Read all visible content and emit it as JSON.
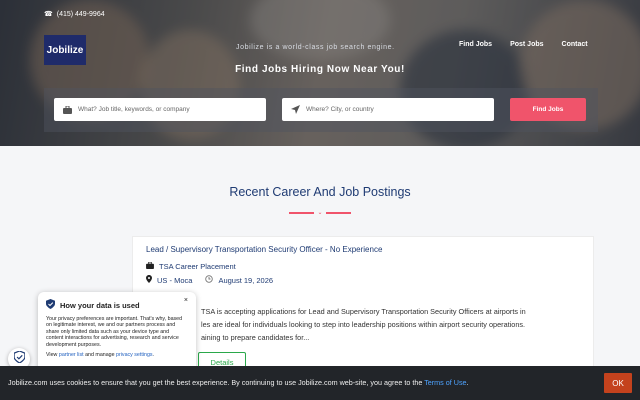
{
  "header": {
    "phone": "(415) 449-9964",
    "logo_text": "Jobilize",
    "tagline": "Jobilize is a world-class job search engine.",
    "nav": [
      "Find Jobs",
      "Post Jobs",
      "Contact"
    ],
    "hero_title": "Find Jobs Hiring Now Near You!"
  },
  "search": {
    "keyword_placeholder": "What? Job title, keywords, or company",
    "location_placeholder": "Where? City, or country",
    "button_label": "Find Jobs"
  },
  "section": {
    "title": "Recent Career And Job Postings"
  },
  "job": {
    "title": "Lead / Supervisory Transportation Security Officer - No Experience",
    "company": "TSA Career Placement",
    "location": "US - Moca",
    "date": "August 19, 2026",
    "desc_lines": [
      "TSA is accepting applications for Lead and Supervisory Transportation Security Officers at airports in",
      "les are ideal for individuals looking to step into leadership positions within airport security operations.",
      "aining to prepare candidates for..."
    ],
    "details_label": "Details"
  },
  "privacy": {
    "title": "How your data is used",
    "close": "×",
    "body": "Your privacy preferences are important. That's why, based on legitimate interest, we and our partners process and share only limited data such as your device type and content interactions for advertising, research and service development purposes.",
    "links_prefix": "View",
    "partner_link": "partner list",
    "links_middle": "and manage",
    "settings_link": "privacy settings",
    "links_suffix": "."
  },
  "cookie": {
    "text": "Jobilize.com uses cookies to ensure that you get the best experience. By continuing to use Jobilize.com web-site, you agree to the",
    "tos_link": "Terms of Use",
    "tos_suffix": ".",
    "ok_label": "OK"
  },
  "colors": {
    "accent": "#f0546b",
    "brand": "#1f2b6a",
    "link": "#1f3b73",
    "details_green": "#2aa84a",
    "ok_button": "#c4421d"
  }
}
